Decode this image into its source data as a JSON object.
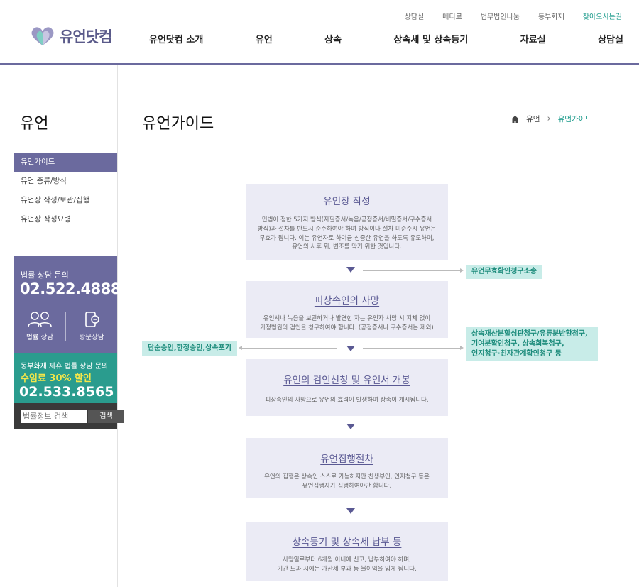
{
  "top_links": [
    "상담실",
    "메디로",
    "법무법인나눔",
    "동부화재",
    "찾아오시는길"
  ],
  "logo": {
    "text": "유언닷컴"
  },
  "gnb": [
    "유언닷컴 소개",
    "유언",
    "상속",
    "상속세 및 상속등기",
    "자료실",
    "상담실"
  ],
  "sidebar": {
    "title": "유언",
    "items": [
      "유언가이드",
      "유언 종류/방식",
      "유언장 작성/보관/집행",
      "유언장 작성요령"
    ],
    "consult": {
      "label": "법률 상담 문의",
      "phone": "02.522.4888",
      "law_label": "법률 상담",
      "visit_label": "방문상담"
    },
    "partner": {
      "line1": "동부화재 제휴 법률 상담 문의",
      "line2": "수임료 30% 할인",
      "phone": "02.533.8565"
    },
    "search": {
      "placeholder": "법률정보 검색",
      "button": "검색"
    }
  },
  "page_title": "유언가이드",
  "breadcrumb": {
    "parent": "유언",
    "current": "유언가이드"
  },
  "flow": [
    {
      "title": "유언장 작성",
      "desc": [
        "민법이 정한 5가지 방식(자필증서/녹음/공정증서/비밀증서/구수증서",
        "방식)과 절차를 반드시 준수하여야 하며 방식이나 절차 미준수시 유언은",
        "무효가 됩니다. 이는 유언자로 하여금 신중한 유언을 하도록 유도하며,",
        "유언의 사후 위, 변조를 막기 위한 것입니다."
      ]
    },
    {
      "title": "피상속인의 사망",
      "desc": [
        "유언서나 녹음을 보관하거나 발견한 자는 유언자 사망 시 지체 없이",
        "가정법원의 검인을 청구하여야 합니다. (공정증서나 구수증서는 제외)"
      ]
    },
    {
      "title": "유언의 검인신청 및 유언서 개봉",
      "desc": [
        "피상속인의 사망으로 유언의 효력이 발생하며 상속이 개시됩니다."
      ]
    },
    {
      "title": "유언집행절차",
      "desc": [
        "유언의 집행은 상속인 스스로 가능하지만 친생부인, 인지청구 등은",
        "유언집행자가 집행하여야만 합니다."
      ]
    },
    {
      "title": "상속등기 및 상속세 납부 등",
      "desc": [
        "사망일로부터 6개월 이내에 신고, 납부하여야 하며,",
        "기간 도과 시에는 가산세 부과 등 불이익을 입게 됩니다."
      ]
    }
  ],
  "side_notes": {
    "invalid": "유언무효확인청구소송",
    "renounce": "단순승인,한정승인,상속포기",
    "claims": [
      "상속재산분할심판청구/유류분반환청구,",
      "기여분확인청구, 상속회복청구,",
      "인지청구·친자관계확인청구 등"
    ]
  },
  "colors": {
    "brand": "#6b6a9e",
    "teal": "#2a9c8e",
    "accent_text": "#1a9a8a"
  }
}
